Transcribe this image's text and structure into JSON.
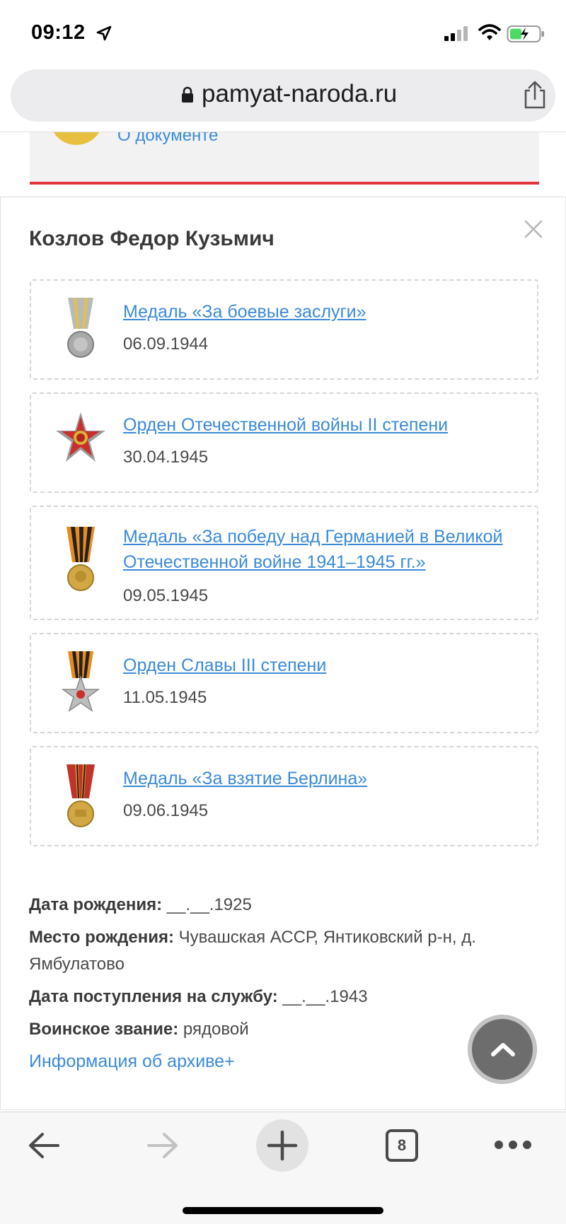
{
  "status_bar": {
    "time": "09:12",
    "icons": [
      "location-icon",
      "signal-icon",
      "wifi-icon",
      "battery-icon"
    ]
  },
  "address_bar": {
    "url": "pamyat-naroda.ru",
    "icons": [
      "lock-icon",
      "share-icon"
    ]
  },
  "background_page": {
    "link_text": "О документе ⌃"
  },
  "modal": {
    "person_name": "Козлов Федор Кузьмич",
    "awards": [
      {
        "title": "Медаль «За боевые заслуги»",
        "date": "06.09.1944",
        "icon": "combat-merit-medal-icon"
      },
      {
        "title": "Орден Отечественной войны II степени",
        "date": "30.04.1945",
        "icon": "patriotic-war-order-icon"
      },
      {
        "title": "Медаль «За победу над Германией в Великой Отечественной войне 1941–1945 гг.»",
        "date": "09.05.1945",
        "icon": "victory-over-germany-medal-icon"
      },
      {
        "title": "Орден Славы III степени",
        "date": "11.05.1945",
        "icon": "order-of-glory-icon"
      },
      {
        "title": "Медаль «За взятие Берлина»",
        "date": "09.06.1945",
        "icon": "capture-of-berlin-medal-icon"
      }
    ],
    "info": {
      "birth_date_label": "Дата рождения:",
      "birth_date_value": " __.__.1925",
      "birth_place_label": "Место рождения:",
      "birth_place_value": " Чувашская АССР, Янтиковский р-н, д. Ямбулатово",
      "service_date_label": "Дата поступления на службу:",
      "service_date_value": " __.__.1943",
      "rank_label": "Воинское звание:",
      "rank_value": " рядовой"
    },
    "archive_link": "Информация об архиве+"
  },
  "toolbar": {
    "tab_count": "8",
    "icons": [
      "back-arrow-icon",
      "forward-arrow-icon",
      "plus-icon",
      "tabs-icon",
      "more-dots-icon"
    ]
  },
  "colors": {
    "link": "#3b8ad9",
    "accent_red": "#e0333a",
    "text": "#4a4a4a"
  }
}
